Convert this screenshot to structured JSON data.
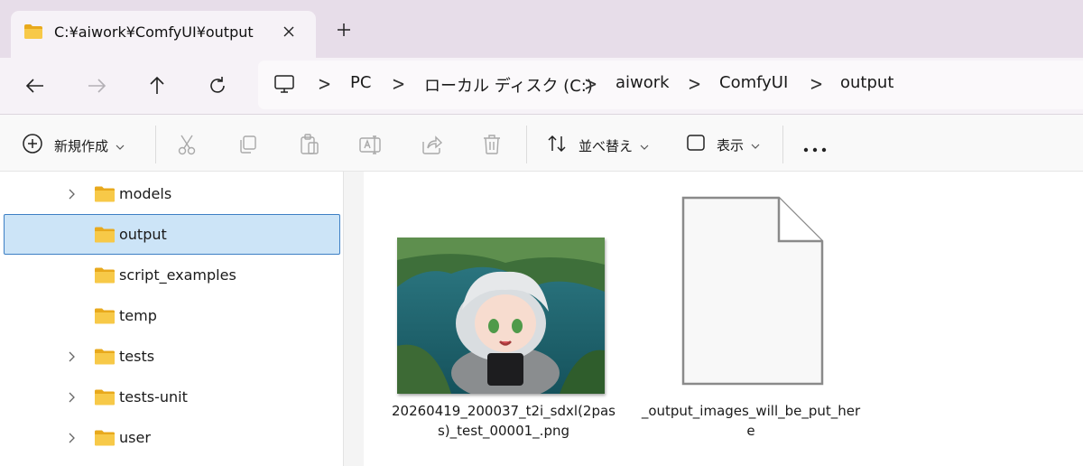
{
  "window": {
    "tab_title": "C:¥aiwork¥ComfyUI¥output"
  },
  "breadcrumb": [
    "PC",
    "ローカル ディスク (C:)",
    "aiwork",
    "ComfyUI",
    "output"
  ],
  "toolbar": {
    "new_label": "新規作成",
    "sort_label": "並べ替え",
    "view_label": "表示"
  },
  "nav_tree": [
    {
      "label": "models",
      "expandable": true,
      "selected": false
    },
    {
      "label": "output",
      "expandable": false,
      "selected": true
    },
    {
      "label": "script_examples",
      "expandable": false,
      "selected": false
    },
    {
      "label": "temp",
      "expandable": false,
      "selected": false
    },
    {
      "label": "tests",
      "expandable": true,
      "selected": false
    },
    {
      "label": "tests-unit",
      "expandable": true,
      "selected": false
    },
    {
      "label": "user",
      "expandable": true,
      "selected": false
    }
  ],
  "files": [
    {
      "name_line1": "20260419_200037_t2i_sdxl(2pas",
      "name_line2": "s)_test_00001_.png",
      "type": "image"
    },
    {
      "name_line1": "_output_images_will_be_put_her",
      "name_line2": "e",
      "type": "document"
    }
  ],
  "colors": {
    "tab_strip": "#e7dde9",
    "nav_background": "#f6f2f7",
    "selection_fill": "#cce4f7",
    "selection_border": "#3d7fc4",
    "folder_yellow": "#f5c542"
  }
}
